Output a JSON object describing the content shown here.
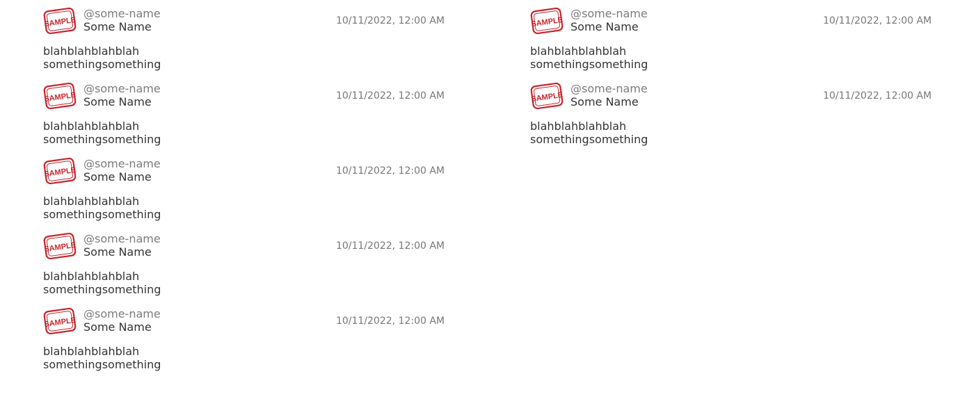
{
  "colors": {
    "stamp_red": "#c8242b",
    "handle_gray": "#7b7b7b",
    "text_dark": "#333333"
  },
  "feed": {
    "left_column": [
      {
        "avatar_icon": "sample-stamp-icon",
        "avatar_text": "SAMPLE",
        "handle": "@some-name",
        "name": "Some Name",
        "timestamp": "10/11/2022, 12:00 AM",
        "text_line1": "blahblahblahblah",
        "text_line2": "somethingsomething"
      },
      {
        "avatar_icon": "sample-stamp-icon",
        "avatar_text": "SAMPLE",
        "handle": "@some-name",
        "name": "Some Name",
        "timestamp": "10/11/2022, 12:00 AM",
        "text_line1": "blahblahblahblah",
        "text_line2": "somethingsomething"
      },
      {
        "avatar_icon": "sample-stamp-icon",
        "avatar_text": "SAMPLE",
        "handle": "@some-name",
        "name": "Some Name",
        "timestamp": "10/11/2022, 12:00 AM",
        "text_line1": "blahblahblahblah",
        "text_line2": "somethingsomething"
      },
      {
        "avatar_icon": "sample-stamp-icon",
        "avatar_text": "SAMPLE",
        "handle": "@some-name",
        "name": "Some Name",
        "timestamp": "10/11/2022, 12:00 AM",
        "text_line1": "blahblahblahblah",
        "text_line2": "somethingsomething"
      },
      {
        "avatar_icon": "sample-stamp-icon",
        "avatar_text": "SAMPLE",
        "handle": "@some-name",
        "name": "Some Name",
        "timestamp": "10/11/2022, 12:00 AM",
        "text_line1": "blahblahblahblah",
        "text_line2": "somethingsomething"
      }
    ],
    "right_column": [
      {
        "avatar_icon": "sample-stamp-icon",
        "avatar_text": "SAMPLE",
        "handle": "@some-name",
        "name": "Some Name",
        "timestamp": "10/11/2022, 12:00 AM",
        "text_line1": "blahblahblahblah",
        "text_line2": "somethingsomething"
      },
      {
        "avatar_icon": "sample-stamp-icon",
        "avatar_text": "SAMPLE",
        "handle": "@some-name",
        "name": "Some Name",
        "timestamp": "10/11/2022, 12:00 AM",
        "text_line1": "blahblahblahblah",
        "text_line2": "somethingsomething"
      }
    ]
  }
}
